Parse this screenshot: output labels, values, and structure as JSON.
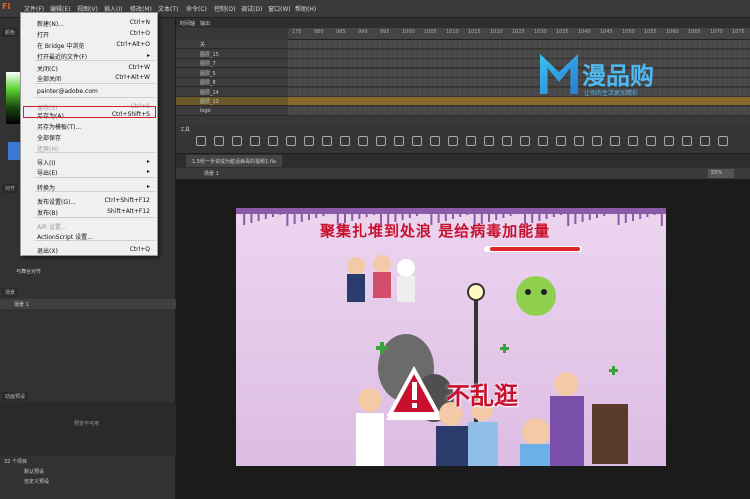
{
  "app": {
    "logo": "Fl"
  },
  "menubar": {
    "items": [
      "文件(F)",
      "编辑(E)",
      "视图(V)",
      "插入(I)",
      "修改(M)",
      "文本(T)",
      "命令(C)",
      "控制(O)",
      "调试(D)",
      "窗口(W)",
      "帮助(H)"
    ]
  },
  "file_menu": {
    "items": [
      {
        "label": "新建(N)...",
        "shortcut": "Ctrl+N"
      },
      {
        "label": "打开",
        "shortcut": "Ctrl+O"
      },
      {
        "label": "在 Bridge 中浏览",
        "shortcut": "Ctrl+Alt+O"
      },
      {
        "label": "打开最近的文件(F)",
        "shortcut": ""
      },
      {
        "label": "关闭(C)",
        "shortcut": "Ctrl+W"
      },
      {
        "label": "全部关闭",
        "shortcut": "Ctrl+Alt+W"
      },
      {
        "label": "painter@adobe.com",
        "shortcut": ""
      },
      {
        "label": "保存(S)",
        "shortcut": "Ctrl+S"
      },
      {
        "label": "另存为(A)...",
        "shortcut": "Ctrl+Shift+S"
      },
      {
        "label": "另存为模板(T)...",
        "shortcut": ""
      },
      {
        "label": "全部保存",
        "shortcut": ""
      },
      {
        "label": "还原(H)",
        "shortcut": ""
      },
      {
        "label": "导入(I)",
        "shortcut": ""
      },
      {
        "label": "导出(E)",
        "shortcut": ""
      },
      {
        "label": "转换为",
        "shortcut": ""
      },
      {
        "label": "发布设置(G)...",
        "shortcut": "Ctrl+Shift+F12"
      },
      {
        "label": "发布(B)",
        "shortcut": "Shift+Alt+F12"
      },
      {
        "label": "AIR 设置...",
        "shortcut": ""
      },
      {
        "label": "ActionScript 设置...",
        "shortcut": ""
      },
      {
        "label": "退出(X)",
        "shortcut": "Ctrl+Q"
      }
    ]
  },
  "timeline": {
    "tabs": [
      "时间轴",
      "输出"
    ],
    "ruler": [
      "175",
      "980",
      "985",
      "990",
      "995",
      "1000",
      "1005",
      "1010",
      "1015",
      "1020",
      "1025",
      "1030",
      "1035",
      "1040",
      "1045",
      "1050",
      "1055",
      "1060",
      "1065",
      "1070",
      "1075"
    ],
    "layers": [
      "关",
      "图层_15",
      "图层_7",
      "图层_5",
      "图层_8",
      "图层_14",
      "图层_12",
      "logo"
    ],
    "frame_info": "975"
  },
  "left_panel": {
    "tabs": [
      "颜色",
      "样本"
    ],
    "align_label": "与舞台对齐",
    "scene_label": "场景",
    "scene_item": "场景 1",
    "preset_tab": "动画预设",
    "preview_text": "预览不可用",
    "preset_count": "32 个项目",
    "preset_folders": [
      "默认预设",
      "自定义预设"
    ]
  },
  "document": {
    "tab_name": "1.5秒一手资成为脏话病毒的视频1.fla",
    "scene": "场景 1",
    "zoom": "55%"
  },
  "stage": {
    "headline": "聚集扎堆到处浪   是给病毒加能量",
    "sign_text": "不乱逛"
  },
  "watermark": {
    "brand": "漫品购",
    "sub": "让你的生活更加精彩"
  },
  "colors": {
    "accent": "#d0262b",
    "stage_bg": "#e6c9ea",
    "headline": "#c8102e"
  }
}
